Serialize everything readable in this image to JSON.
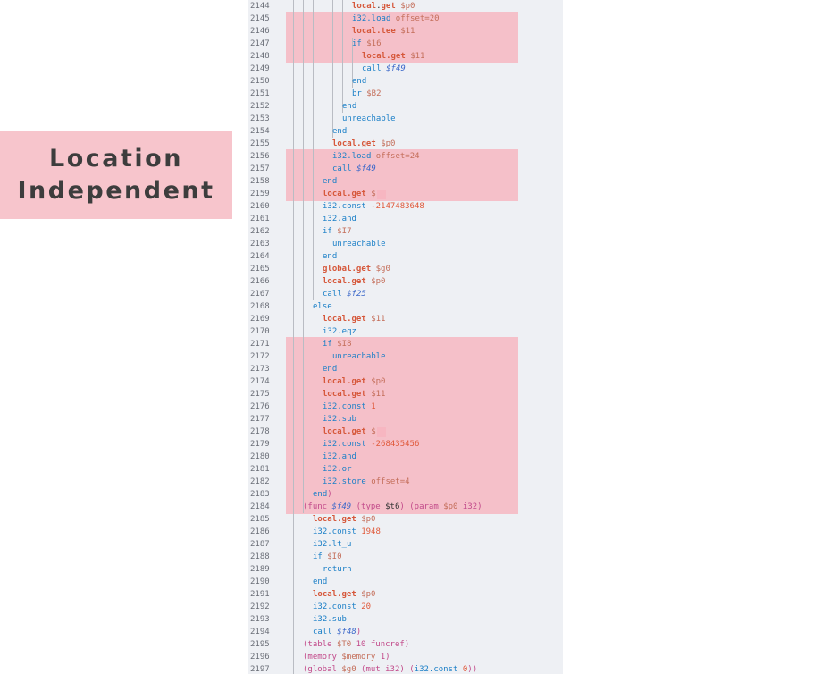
{
  "label": {
    "line1": "Location",
    "line2": "Independent"
  },
  "code": {
    "lines": [
      {
        "n": "2144",
        "indent": 5,
        "tokens": [
          [
            "local",
            "op"
          ],
          [
            ".",
            "dot"
          ],
          [
            "get",
            "op"
          ],
          [
            " $p0",
            "var"
          ]
        ]
      },
      {
        "n": "2145",
        "indent": 5,
        "tokens": [
          [
            "i32",
            "kw"
          ],
          [
            ".load",
            "kw"
          ],
          [
            " offset=20",
            "var"
          ]
        ]
      },
      {
        "n": "2146",
        "indent": 5,
        "tokens": [
          [
            "local",
            "op"
          ],
          [
            ".tee",
            "op"
          ],
          [
            " $11",
            "var"
          ]
        ]
      },
      {
        "n": "2147",
        "indent": 5,
        "tokens": [
          [
            "if",
            "kw"
          ],
          [
            " $16",
            "var"
          ]
        ]
      },
      {
        "n": "2148",
        "indent": 6,
        "tokens": [
          [
            "local",
            "op"
          ],
          [
            ".get",
            "op"
          ],
          [
            " $11",
            "var"
          ]
        ]
      },
      {
        "n": "2149",
        "indent": 6,
        "tokens": [
          [
            "call",
            "kw"
          ],
          [
            " $f49",
            "fn"
          ]
        ]
      },
      {
        "n": "2150",
        "indent": 5,
        "tokens": [
          [
            "end",
            "kw"
          ]
        ]
      },
      {
        "n": "2151",
        "indent": 5,
        "tokens": [
          [
            "br",
            "kw"
          ],
          [
            " $B2",
            "var"
          ]
        ]
      },
      {
        "n": "2152",
        "indent": 4,
        "tokens": [
          [
            "end",
            "kw"
          ]
        ]
      },
      {
        "n": "2153",
        "indent": 4,
        "tokens": [
          [
            "unreachable",
            "kw"
          ]
        ]
      },
      {
        "n": "2154",
        "indent": 3,
        "tokens": [
          [
            "end",
            "kw"
          ]
        ]
      },
      {
        "n": "2155",
        "indent": 3,
        "tokens": [
          [
            "local",
            "op"
          ],
          [
            ".get",
            "op"
          ],
          [
            " $p0",
            "var"
          ]
        ]
      },
      {
        "n": "2156",
        "indent": 3,
        "tokens": [
          [
            "i32",
            "kw"
          ],
          [
            ".load",
            "kw"
          ],
          [
            " offset=24",
            "var"
          ]
        ]
      },
      {
        "n": "2157",
        "indent": 3,
        "tokens": [
          [
            "call",
            "kw"
          ],
          [
            " $f49",
            "fn"
          ]
        ]
      },
      {
        "n": "2158",
        "indent": 2,
        "tokens": [
          [
            "end",
            "kw"
          ]
        ]
      },
      {
        "n": "2159",
        "indent": 2,
        "tokens": [
          [
            "local",
            "op"
          ],
          [
            ".get",
            "op"
          ],
          [
            " $",
            "var"
          ]
        ]
      },
      {
        "n": "2160",
        "indent": 2,
        "tokens": [
          [
            "i32",
            "kw"
          ],
          [
            ".const",
            "kw"
          ],
          [
            " -2147483648",
            "num"
          ]
        ]
      },
      {
        "n": "2161",
        "indent": 2,
        "tokens": [
          [
            "i32",
            "kw"
          ],
          [
            ".and",
            "kw"
          ]
        ]
      },
      {
        "n": "2162",
        "indent": 2,
        "tokens": [
          [
            "if",
            "kw"
          ],
          [
            " $I7",
            "var"
          ]
        ]
      },
      {
        "n": "2163",
        "indent": 3,
        "tokens": [
          [
            "unreachable",
            "kw"
          ]
        ]
      },
      {
        "n": "2164",
        "indent": 2,
        "tokens": [
          [
            "end",
            "kw"
          ]
        ]
      },
      {
        "n": "2165",
        "indent": 2,
        "tokens": [
          [
            "global",
            "op"
          ],
          [
            ".get",
            "op"
          ],
          [
            " $g0",
            "var"
          ]
        ]
      },
      {
        "n": "2166",
        "indent": 2,
        "tokens": [
          [
            "local",
            "op"
          ],
          [
            ".get",
            "op"
          ],
          [
            " $p0",
            "var"
          ]
        ]
      },
      {
        "n": "2167",
        "indent": 2,
        "tokens": [
          [
            "call",
            "kw"
          ],
          [
            " $f25",
            "fn"
          ]
        ]
      },
      {
        "n": "2168",
        "indent": 1,
        "tokens": [
          [
            "else",
            "kw"
          ]
        ]
      },
      {
        "n": "2169",
        "indent": 2,
        "tokens": [
          [
            "local",
            "op"
          ],
          [
            ".get",
            "op"
          ],
          [
            " $11",
            "var"
          ]
        ]
      },
      {
        "n": "2170",
        "indent": 2,
        "tokens": [
          [
            "i32",
            "kw"
          ],
          [
            ".eqz",
            "kw"
          ]
        ]
      },
      {
        "n": "2171",
        "indent": 2,
        "tokens": [
          [
            "if",
            "kw"
          ],
          [
            " $I8",
            "var"
          ]
        ]
      },
      {
        "n": "2172",
        "indent": 3,
        "tokens": [
          [
            "unreachable",
            "kw"
          ]
        ]
      },
      {
        "n": "2173",
        "indent": 2,
        "tokens": [
          [
            "end",
            "kw"
          ]
        ]
      },
      {
        "n": "2174",
        "indent": 2,
        "tokens": [
          [
            "local",
            "op"
          ],
          [
            ".get",
            "op"
          ],
          [
            " $p0",
            "var"
          ]
        ]
      },
      {
        "n": "2175",
        "indent": 2,
        "tokens": [
          [
            "local",
            "op"
          ],
          [
            ".get",
            "op"
          ],
          [
            " $11",
            "var"
          ]
        ]
      },
      {
        "n": "2176",
        "indent": 2,
        "tokens": [
          [
            "i32",
            "kw"
          ],
          [
            ".const",
            "kw"
          ],
          [
            " 1",
            "num"
          ]
        ]
      },
      {
        "n": "2177",
        "indent": 2,
        "tokens": [
          [
            "i32",
            "kw"
          ],
          [
            ".sub",
            "kw"
          ]
        ]
      },
      {
        "n": "2178",
        "indent": 2,
        "tokens": [
          [
            "local",
            "op"
          ],
          [
            ".get",
            "op"
          ],
          [
            " $",
            "var"
          ]
        ]
      },
      {
        "n": "2179",
        "indent": 2,
        "tokens": [
          [
            "i32",
            "kw"
          ],
          [
            ".const",
            "kw"
          ],
          [
            " -268435456",
            "num"
          ]
        ]
      },
      {
        "n": "2180",
        "indent": 2,
        "tokens": [
          [
            "i32",
            "kw"
          ],
          [
            ".and",
            "kw"
          ]
        ]
      },
      {
        "n": "2181",
        "indent": 2,
        "tokens": [
          [
            "i32",
            "kw"
          ],
          [
            ".or",
            "kw"
          ]
        ]
      },
      {
        "n": "2182",
        "indent": 2,
        "tokens": [
          [
            "i32",
            "kw"
          ],
          [
            ".store",
            "kw"
          ],
          [
            " offset=4",
            "var"
          ]
        ]
      },
      {
        "n": "2183",
        "indent": 1,
        "tokens": [
          [
            "end",
            "kw"
          ],
          [
            ")",
            "paren"
          ]
        ]
      },
      {
        "n": "2184",
        "indent": 0,
        "tokens": [
          [
            "(func ",
            "paren"
          ],
          [
            "$f49",
            "fn"
          ],
          [
            " (type ",
            "paren"
          ],
          [
            "$t6",
            "plain"
          ],
          [
            ") (param ",
            "paren"
          ],
          [
            "$p0",
            "var"
          ],
          [
            " i32)",
            "paren"
          ]
        ]
      },
      {
        "n": "2185",
        "indent": 1,
        "tokens": [
          [
            "local",
            "op"
          ],
          [
            ".get",
            "op"
          ],
          [
            " $p0",
            "var"
          ]
        ]
      },
      {
        "n": "2186",
        "indent": 1,
        "tokens": [
          [
            "i32",
            "kw"
          ],
          [
            ".const",
            "kw"
          ],
          [
            " 1948",
            "num"
          ]
        ]
      },
      {
        "n": "2187",
        "indent": 1,
        "tokens": [
          [
            "i32",
            "kw"
          ],
          [
            ".lt_u",
            "kw"
          ]
        ]
      },
      {
        "n": "2188",
        "indent": 1,
        "tokens": [
          [
            "if",
            "kw"
          ],
          [
            " $I0",
            "var"
          ]
        ]
      },
      {
        "n": "2189",
        "indent": 2,
        "tokens": [
          [
            "return",
            "kw"
          ]
        ]
      },
      {
        "n": "2190",
        "indent": 1,
        "tokens": [
          [
            "end",
            "kw"
          ]
        ]
      },
      {
        "n": "2191",
        "indent": 1,
        "tokens": [
          [
            "local",
            "op"
          ],
          [
            ".get",
            "op"
          ],
          [
            " $p0",
            "var"
          ]
        ]
      },
      {
        "n": "2192",
        "indent": 1,
        "tokens": [
          [
            "i32",
            "kw"
          ],
          [
            ".const",
            "kw"
          ],
          [
            " 20",
            "num"
          ]
        ]
      },
      {
        "n": "2193",
        "indent": 1,
        "tokens": [
          [
            "i32",
            "kw"
          ],
          [
            ".sub",
            "kw"
          ]
        ]
      },
      {
        "n": "2194",
        "indent": 1,
        "tokens": [
          [
            "call",
            "kw"
          ],
          [
            " $f48",
            "fn"
          ],
          [
            ")",
            "paren"
          ]
        ]
      },
      {
        "n": "2195",
        "indent": 0,
        "tokens": [
          [
            "(table ",
            "paren"
          ],
          [
            "$T0",
            "var"
          ],
          [
            " 10 funcref)",
            "paren"
          ]
        ]
      },
      {
        "n": "2196",
        "indent": 0,
        "tokens": [
          [
            "(memory ",
            "paren"
          ],
          [
            "$memory",
            "var"
          ],
          [
            " 1)",
            "paren"
          ]
        ]
      },
      {
        "n": "2197",
        "indent": 0,
        "tokens": [
          [
            "(global ",
            "paren"
          ],
          [
            "$g0",
            "var"
          ],
          [
            " (mut i32) (",
            "paren"
          ],
          [
            "i32",
            "kw"
          ],
          [
            ".const",
            "kw"
          ],
          [
            " 0",
            "num"
          ],
          [
            "))",
            "paren"
          ]
        ]
      }
    ]
  }
}
